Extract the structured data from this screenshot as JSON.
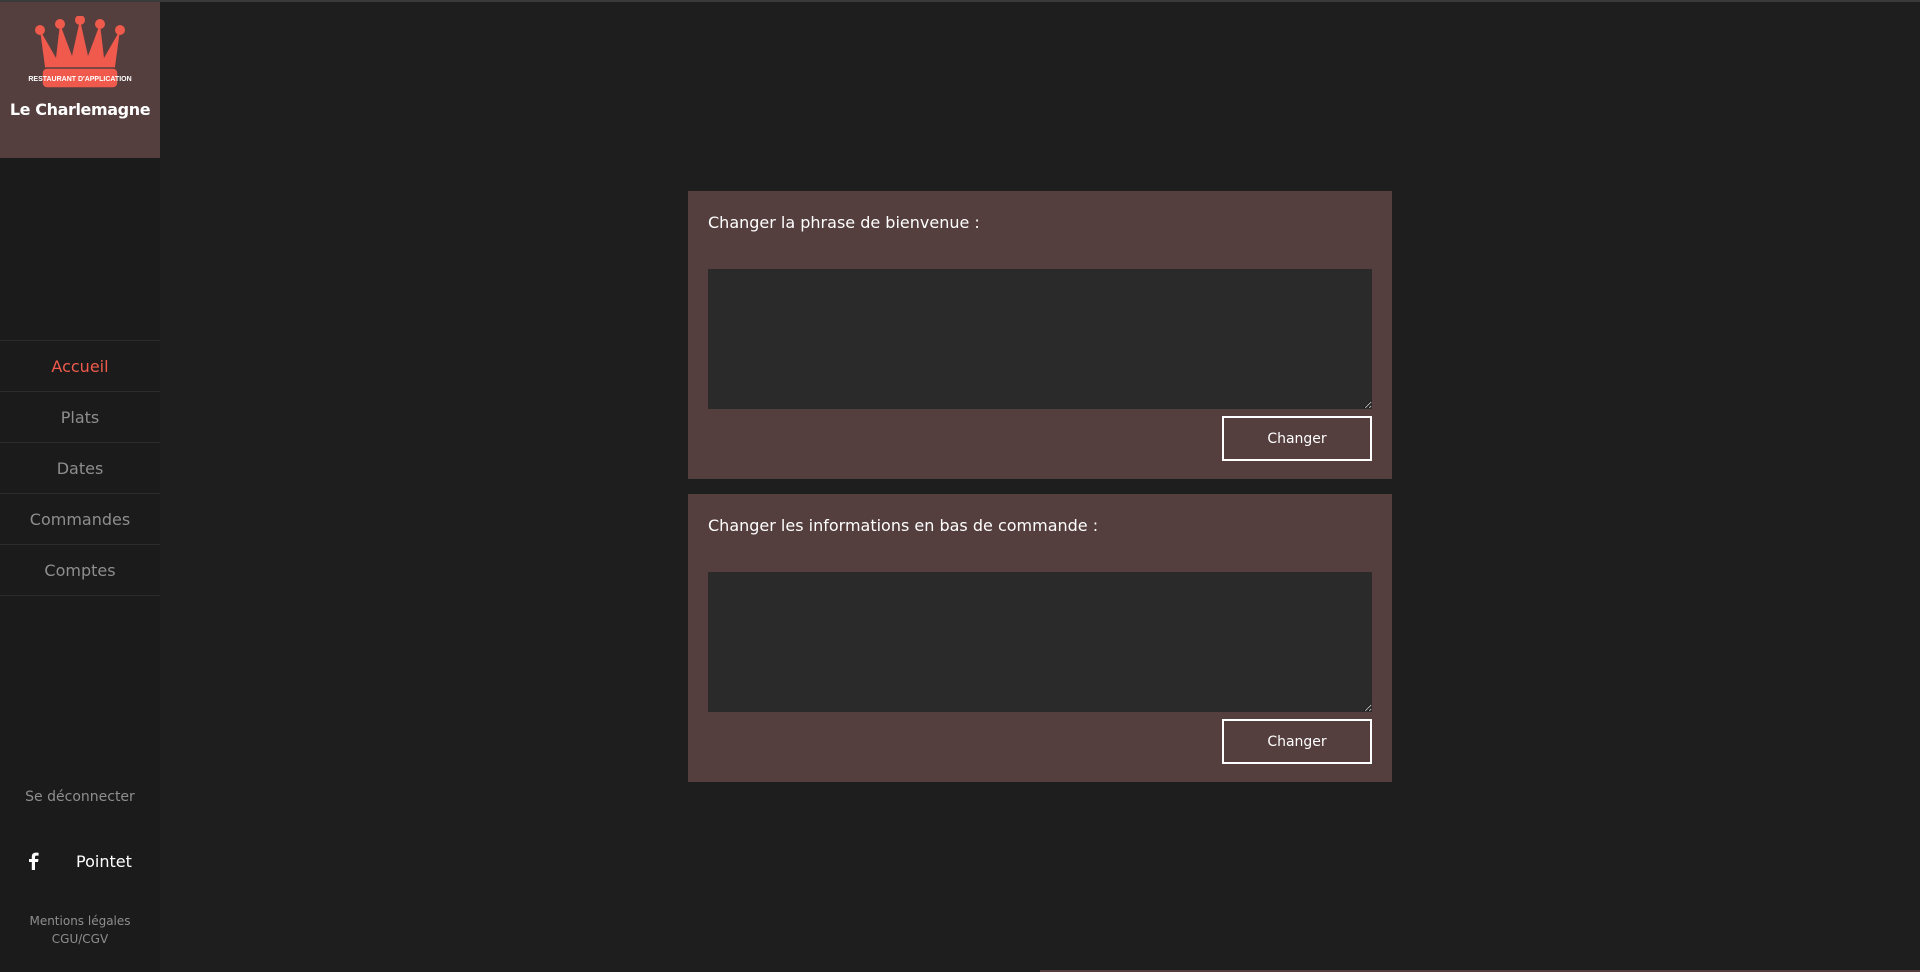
{
  "brand": {
    "badge_text": "RESTAURANT D'APPLICATION",
    "name": "Le Charlemagne",
    "logo_icon": "crown-icon",
    "accent_color": "#f05a4c"
  },
  "nav": {
    "items": [
      {
        "label": "Accueil",
        "active": true
      },
      {
        "label": "Plats",
        "active": false
      },
      {
        "label": "Dates",
        "active": false
      },
      {
        "label": "Commandes",
        "active": false
      },
      {
        "label": "Comptes",
        "active": false
      }
    ],
    "logout_label": "Se déconnecter"
  },
  "social": {
    "icon": "facebook-icon",
    "name": "Pointet"
  },
  "legal": {
    "mentions": "Mentions légales",
    "cgu": "CGU/CGV"
  },
  "panels": [
    {
      "title": "Changer la phrase de bienvenue :",
      "value": "",
      "button_label": "Changer"
    },
    {
      "title": "Changer les informations en bas de commande :",
      "value": "",
      "button_label": "Changer"
    }
  ]
}
